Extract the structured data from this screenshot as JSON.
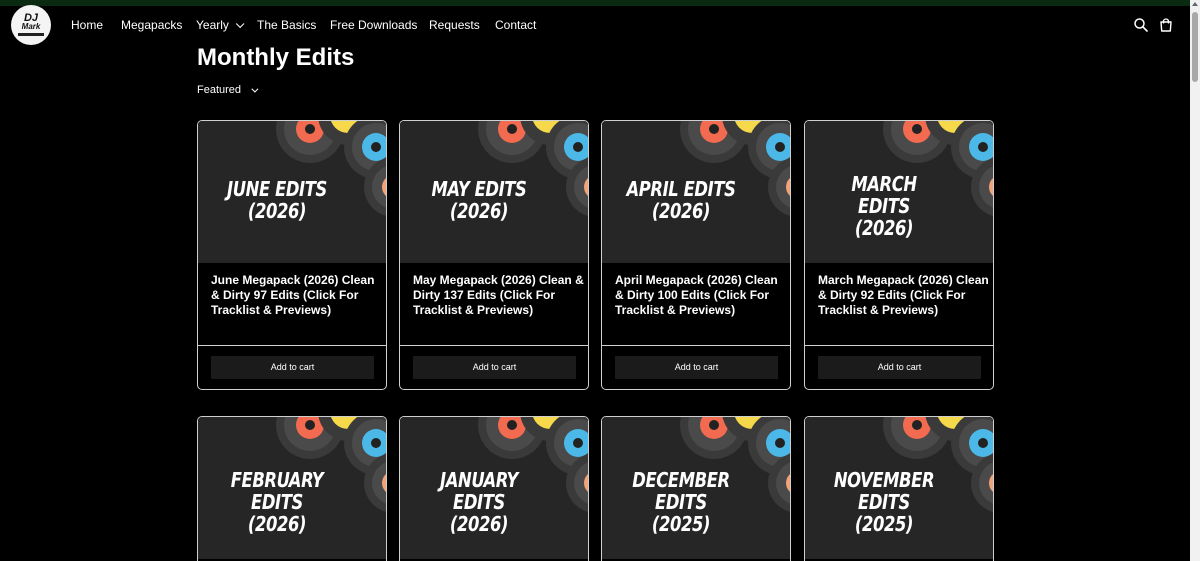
{
  "logo": {
    "line1": "DJ",
    "line2": "Mark"
  },
  "nav": {
    "items": [
      {
        "label": "Home"
      },
      {
        "label": "Megapacks"
      },
      {
        "label": "Yearly"
      },
      {
        "label": "The Basics"
      },
      {
        "label": "Free Downloads"
      },
      {
        "label": "Requests"
      },
      {
        "label": "Contact"
      }
    ],
    "icons": [
      "search-icon",
      "cart-icon"
    ]
  },
  "page": {
    "title": "Monthly Edits",
    "sort_label": "Featured"
  },
  "products": [
    {
      "image_lines": [
        "JUNE EDITS",
        "(2026)"
      ],
      "title": "June Megapack (2026) Clean & Dirty 97 Edits (Click For Tracklist & Previews)",
      "button": "Add to cart"
    },
    {
      "image_lines": [
        "MAY EDITS",
        "(2026)"
      ],
      "title": "May Megapack (2026) Clean & Dirty 137 Edits (Click For Tracklist & Previews)",
      "button": "Add to cart"
    },
    {
      "image_lines": [
        "APRIL EDITS",
        "(2026)"
      ],
      "title": "April Megapack (2026) Clean & Dirty 100 Edits (Click For Tracklist & Previews)",
      "button": "Add to cart"
    },
    {
      "image_lines": [
        "MARCH",
        "EDITS",
        "(2026)"
      ],
      "title": "March Megapack (2026) Clean & Dirty 92 Edits (Click For Tracklist & Previews)",
      "button": "Add to cart"
    },
    {
      "image_lines": [
        "FEBRUARY",
        "EDITS",
        "(2026)"
      ],
      "title": "",
      "button": ""
    },
    {
      "image_lines": [
        "JANUARY",
        "EDITS",
        "(2026)"
      ],
      "title": "",
      "button": ""
    },
    {
      "image_lines": [
        "DECEMBER",
        "EDITS",
        "(2025)"
      ],
      "title": "",
      "button": ""
    },
    {
      "image_lines": [
        "NOVEMBER",
        "EDITS",
        "(2025)"
      ],
      "title": "",
      "button": ""
    }
  ],
  "colors": {
    "background": "#000000",
    "card_border": "#cfcfcf",
    "button_bg": "#1b1b1b",
    "record_orange": "#f26a4f",
    "record_yellow": "#f5d94a",
    "record_blue": "#4bb8e8",
    "record_peach": "#f2a27a"
  }
}
